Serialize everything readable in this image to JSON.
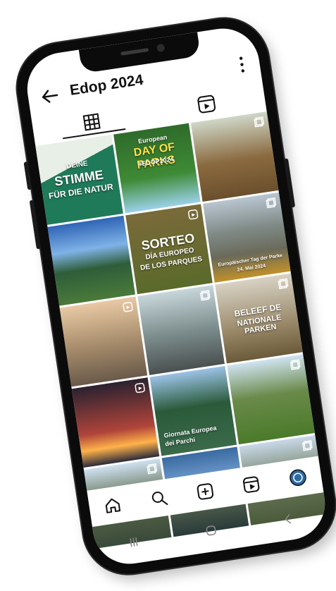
{
  "header": {
    "title": "Edop 2024"
  },
  "tiles": [
    {
      "text_line1": "DEINE",
      "text_line2": "STIMME",
      "text_line3": "FÜR DIE NATUR",
      "bg": "#1f7a5a"
    },
    {
      "text_line1": "European",
      "text_line2": "DAY OF PARKS",
      "text_line3": "#EDOP2024",
      "bg": "#2f6b2b"
    },
    {
      "text_line1": "",
      "text_line2": "",
      "text_line3": "",
      "bg": "#8a6a3f"
    },
    {
      "text_line1": "",
      "text_line2": "",
      "text_line3": "",
      "bg": "#3b6fb3"
    },
    {
      "text_line1": "SORTEO",
      "text_line2": "DÍA EUROPEO",
      "text_line3": "DE LOS PARQUES",
      "bg": "#7a6a3a"
    },
    {
      "text_line1": "Europäischer Tag der Parke",
      "text_line2": "24. Mai 2024",
      "text_line3": "",
      "bg": "#6a6a5a"
    },
    {
      "text_line1": "",
      "text_line2": "",
      "text_line3": "",
      "bg": "#a48a6a"
    },
    {
      "text_line1": "",
      "text_line2": "",
      "text_line3": "",
      "bg": "#7a8a8a"
    },
    {
      "text_line1": "BELEEF DE",
      "text_line2": "NATIONALE PARKEN",
      "text_line3": "",
      "bg": "#9a8a6a"
    },
    {
      "text_line1": "",
      "text_line2": "",
      "text_line3": "",
      "bg": "#3a2a3a"
    },
    {
      "text_line1": "Giornata Europea",
      "text_line2": "dei Parchi",
      "text_line3": "",
      "bg": "#2a5a3a"
    },
    {
      "text_line1": "",
      "text_line2": "",
      "text_line3": "",
      "bg": "#6a8a4a"
    },
    {
      "text_line1": "",
      "text_line2": "",
      "text_line3": "",
      "bg": "#5a6a4a"
    },
    {
      "text_line1": "",
      "text_line2": "",
      "text_line3": "",
      "bg": "#3a6aa0"
    },
    {
      "text_line1": "",
      "text_line2": "",
      "text_line3": "",
      "bg": "#6a7a5a"
    }
  ],
  "colors": {
    "accent": "#111111",
    "screen_bg": "#ffffff",
    "phone_body": "#0b0b0b"
  },
  "icons": {
    "back": "arrow-left-icon",
    "more": "more-vertical-icon",
    "grid": "grid-icon",
    "reels": "reels-icon",
    "home": "home-icon",
    "search": "search-icon",
    "add": "add-post-icon",
    "profile": "profile-icon"
  }
}
